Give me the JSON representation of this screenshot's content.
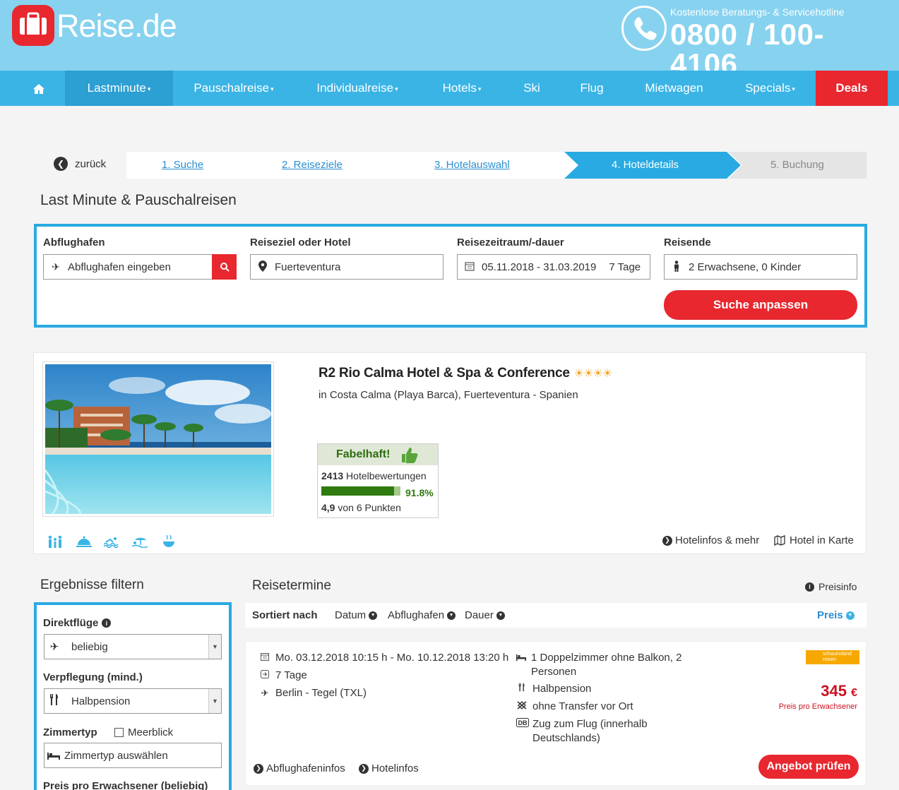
{
  "brand": {
    "name": "Reise",
    "tld": ".de",
    "hotline_label": "Kostenlose Beratungs- & Servicehotline",
    "hotline_number": "0800 / 100-4106",
    "colors": {
      "primary": "#3ab4e5",
      "accent": "#e8272f",
      "header_bg": "#87d2ef"
    }
  },
  "nav": {
    "home_icon": "home-icon",
    "items": [
      {
        "label": "Lastminute",
        "caret": true
      },
      {
        "label": "Pauschalreise",
        "caret": true
      },
      {
        "label": "Individualreise",
        "caret": true
      },
      {
        "label": "Hotels",
        "caret": true
      },
      {
        "label": "Ski",
        "caret": false
      },
      {
        "label": "Flug",
        "caret": false
      },
      {
        "label": "Mietwagen",
        "caret": false
      },
      {
        "label": "Specials",
        "caret": true
      },
      {
        "label": "Deals",
        "caret": false
      }
    ]
  },
  "steps": {
    "back": "zurück",
    "items": [
      "1. Suche",
      "2. Reiseziele",
      "3. Hotelauswahl",
      "4. Hoteldetails",
      "5. Buchung"
    ],
    "active": 3
  },
  "page_title": "Last Minute & Pauschalreisen",
  "search": {
    "departure": {
      "label": "Abflughafen",
      "placeholder": "Abflughafen eingeben"
    },
    "destination": {
      "label": "Reiseziel oder Hotel",
      "value": "Fuerteventura"
    },
    "period": {
      "label": "Reisezeitraum/-dauer",
      "value": "05.11.2018 - 31.03.2019",
      "duration": "7 Tage"
    },
    "travelers": {
      "label": "Reisende",
      "value": "2 Erwachsene, 0 Kinder"
    },
    "submit": "Suche anpassen"
  },
  "hotel": {
    "name": "R2 Rio Calma Hotel & Spa & Conference",
    "stars": 4,
    "stars_text": "☀☀☀☀",
    "location": "in Costa Calma (Playa Barca), Fuerteventura - Spanien",
    "rating": {
      "label": "Fabelhaft!",
      "count": "2413",
      "count_label": "Hotelbewertungen",
      "percent_text": "91.8%",
      "percent": 0.918,
      "score": "4,9",
      "score_label": "von 6 Punkten"
    },
    "amenities": [
      "family-icon",
      "room-service-icon",
      "swimming-icon",
      "beach-icon",
      "spa-icon"
    ],
    "links": {
      "info": "Hotelinfos & mehr",
      "map": "Hotel in Karte"
    }
  },
  "filters": {
    "title": "Ergebnisse filtern",
    "direct": {
      "label": "Direktflüge",
      "value": "beliebig"
    },
    "board": {
      "label": "Verpflegung (mind.)",
      "value": "Halbpension"
    },
    "room": {
      "label": "Zimmertyp",
      "checkbox": "Meerblick",
      "placeholder": "Zimmertyp auswählen"
    },
    "price_label": "Preis pro Erwachsener (beliebig)"
  },
  "results": {
    "title": "Reisetermine",
    "price_info": "Preisinfo",
    "sort": {
      "label": "Sortiert nach",
      "date": "Datum",
      "airport": "Abflughafen",
      "duration": "Dauer",
      "price": "Preis"
    },
    "offer": {
      "dates": "Mo. 03.12.2018 10:15 h - Mo. 10.12.2018 13:20 h",
      "duration": "7 Tage",
      "route": "Berlin - Tegel (TXL)",
      "room": "1 Doppelzimmer ohne Balkon, 2 Personen",
      "board": "Halbpension",
      "transfer": "ohne Transfer vor Ort",
      "train": "Zug zum Flug (innerhalb Deutschlands)",
      "operator": "schauinsland reisen",
      "price": "345",
      "currency": "€",
      "price_label": "Preis pro Erwachsener",
      "links": {
        "airport": "Abflughafeninfos",
        "hotel": "Hotelinfos"
      },
      "cta": "Angebot prüfen"
    }
  }
}
